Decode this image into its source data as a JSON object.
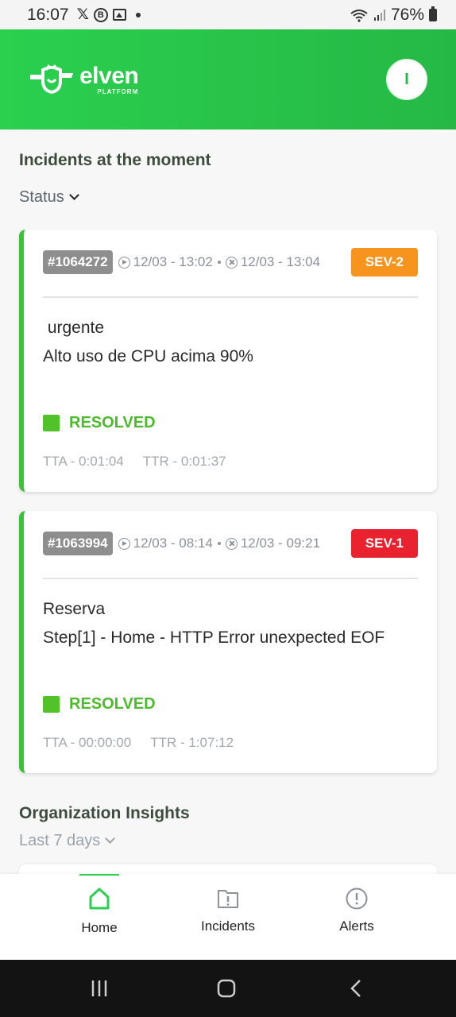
{
  "status_bar": {
    "time": "16:07",
    "battery": "76%"
  },
  "header": {
    "logo_name": "elven",
    "logo_sub": "PLATFORM",
    "avatar_initial": "I",
    "colors": {
      "primary": "#2bd04f"
    }
  },
  "incidents_section": {
    "title": "Incidents at the moment",
    "filter_label": "Status"
  },
  "incidents": [
    {
      "id": "#1064272",
      "started": "12/03 - 13:02",
      "resolved": "12/03 - 13:04",
      "severity": "SEV-2",
      "severity_color": "#f7941d",
      "line1": " urgente",
      "line2": "Alto uso de CPU acima 90%",
      "status": "RESOLVED",
      "tta": "TTA - 0:01:04",
      "ttr": "TTR - 0:01:37"
    },
    {
      "id": "#1063994",
      "started": "12/03 - 08:14",
      "resolved": "12/03 - 09:21",
      "severity": "SEV-1",
      "severity_color": "#e8222e",
      "line1": "Reserva",
      "line2": "Step[1] - Home - HTTP Error unexpected EOF",
      "status": "RESOLVED",
      "tta": "TTA - 00:00:00",
      "ttr": "TTR - 1:07:12"
    }
  ],
  "insights_section": {
    "title": "Organization Insights",
    "filter_label": "Last 7 days"
  },
  "bottom_nav": {
    "items": [
      {
        "label": "Home",
        "icon": "home-icon",
        "active": true
      },
      {
        "label": "Incidents",
        "icon": "folder-alert-icon"
      },
      {
        "label": "Alerts",
        "icon": "alert-circle-icon"
      }
    ]
  }
}
